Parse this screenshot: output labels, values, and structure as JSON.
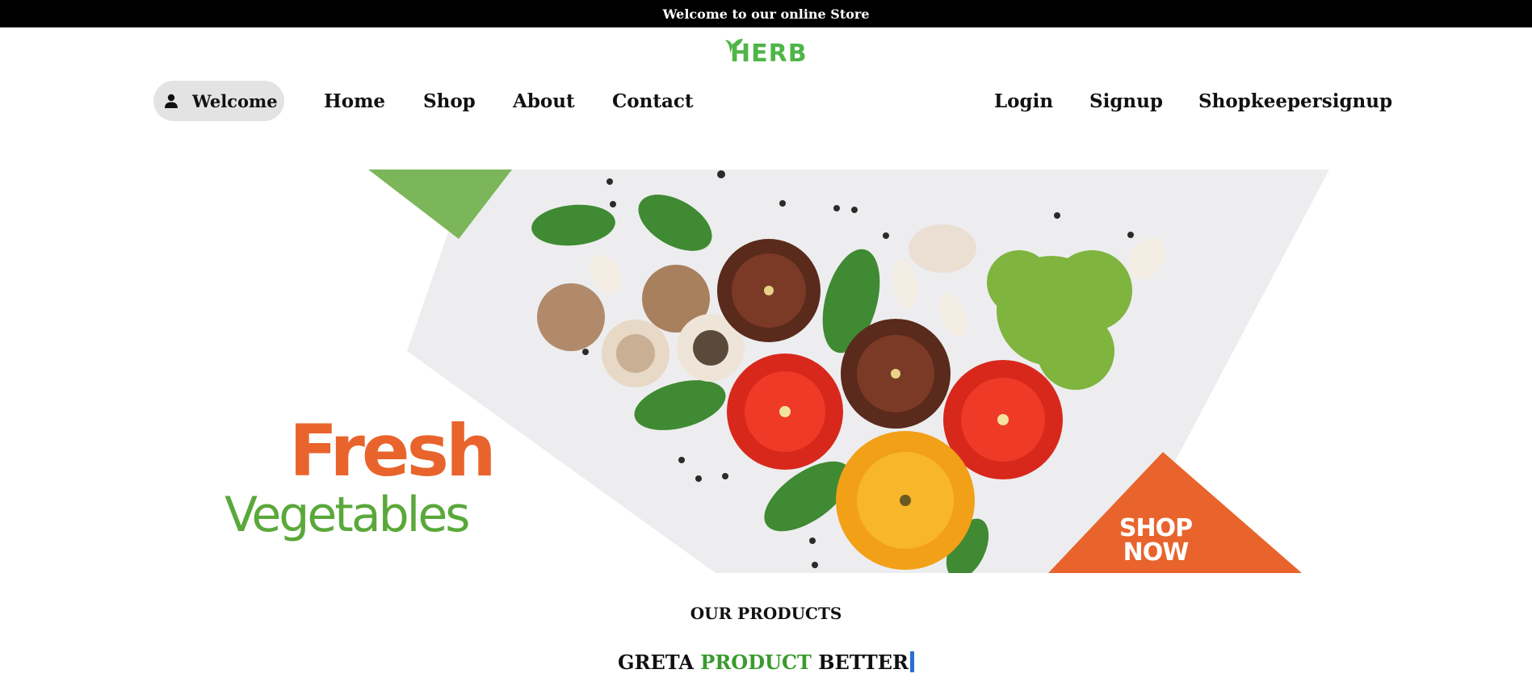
{
  "announcement": "Welcome to our online Store",
  "brand": {
    "logo_text": "HERB",
    "color": "#4fb547"
  },
  "nav": {
    "welcome_label": "Welcome",
    "welcome_icon": "user-icon",
    "left_links": [
      "Home",
      "Shop",
      "About",
      "Contact"
    ],
    "right_links": [
      "Login",
      "Signup",
      "Shopkeepersignup"
    ]
  },
  "banner": {
    "headline": "Fresh",
    "subheadline": "Vegetables",
    "cta": "SHOP\nNOW",
    "colors": {
      "headline": "#e8642c",
      "subheadline": "#5aa83a",
      "cta_triangle": "#e8642c",
      "accent_triangle": "#7cb65a"
    }
  },
  "products": {
    "heading": "OUR PRODUCTS",
    "tagline_part1": "GRETA",
    "tagline_accent": "PRODUCT",
    "tagline_part2": "BETTER",
    "accent_color": "#3a9a2e"
  }
}
